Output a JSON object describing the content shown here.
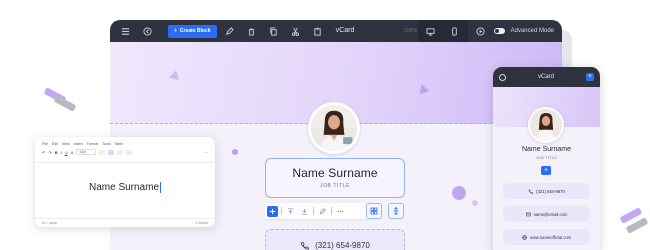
{
  "editor": {
    "title": "vCard",
    "zoom": "100%",
    "create_block_label": "Create Block",
    "advanced_mode_label": "Advanced Mode",
    "advanced_mode_on": false
  },
  "card": {
    "name": "Name Surname",
    "job_title": "JOB TITLE",
    "phone": "(321) 654-9870"
  },
  "text_editor": {
    "menu": [
      "File",
      "Edit",
      "View",
      "Insert",
      "Format",
      "Tools",
      "Table"
    ],
    "font_size": "10pt",
    "content": "Name Surname",
    "footer_left": "h1 › span",
    "footer_right": "2 words"
  },
  "mobile": {
    "title": "vCard",
    "name": "Name Surname",
    "job_title": "JOB TITLE",
    "phone": "(321) 654-9870",
    "email": "name@email.com",
    "website": "www.nameofficial.com"
  },
  "colors": {
    "accent": "#2d6df6",
    "toolbar": "#2f3340",
    "lavender": "#e2d4fb"
  }
}
